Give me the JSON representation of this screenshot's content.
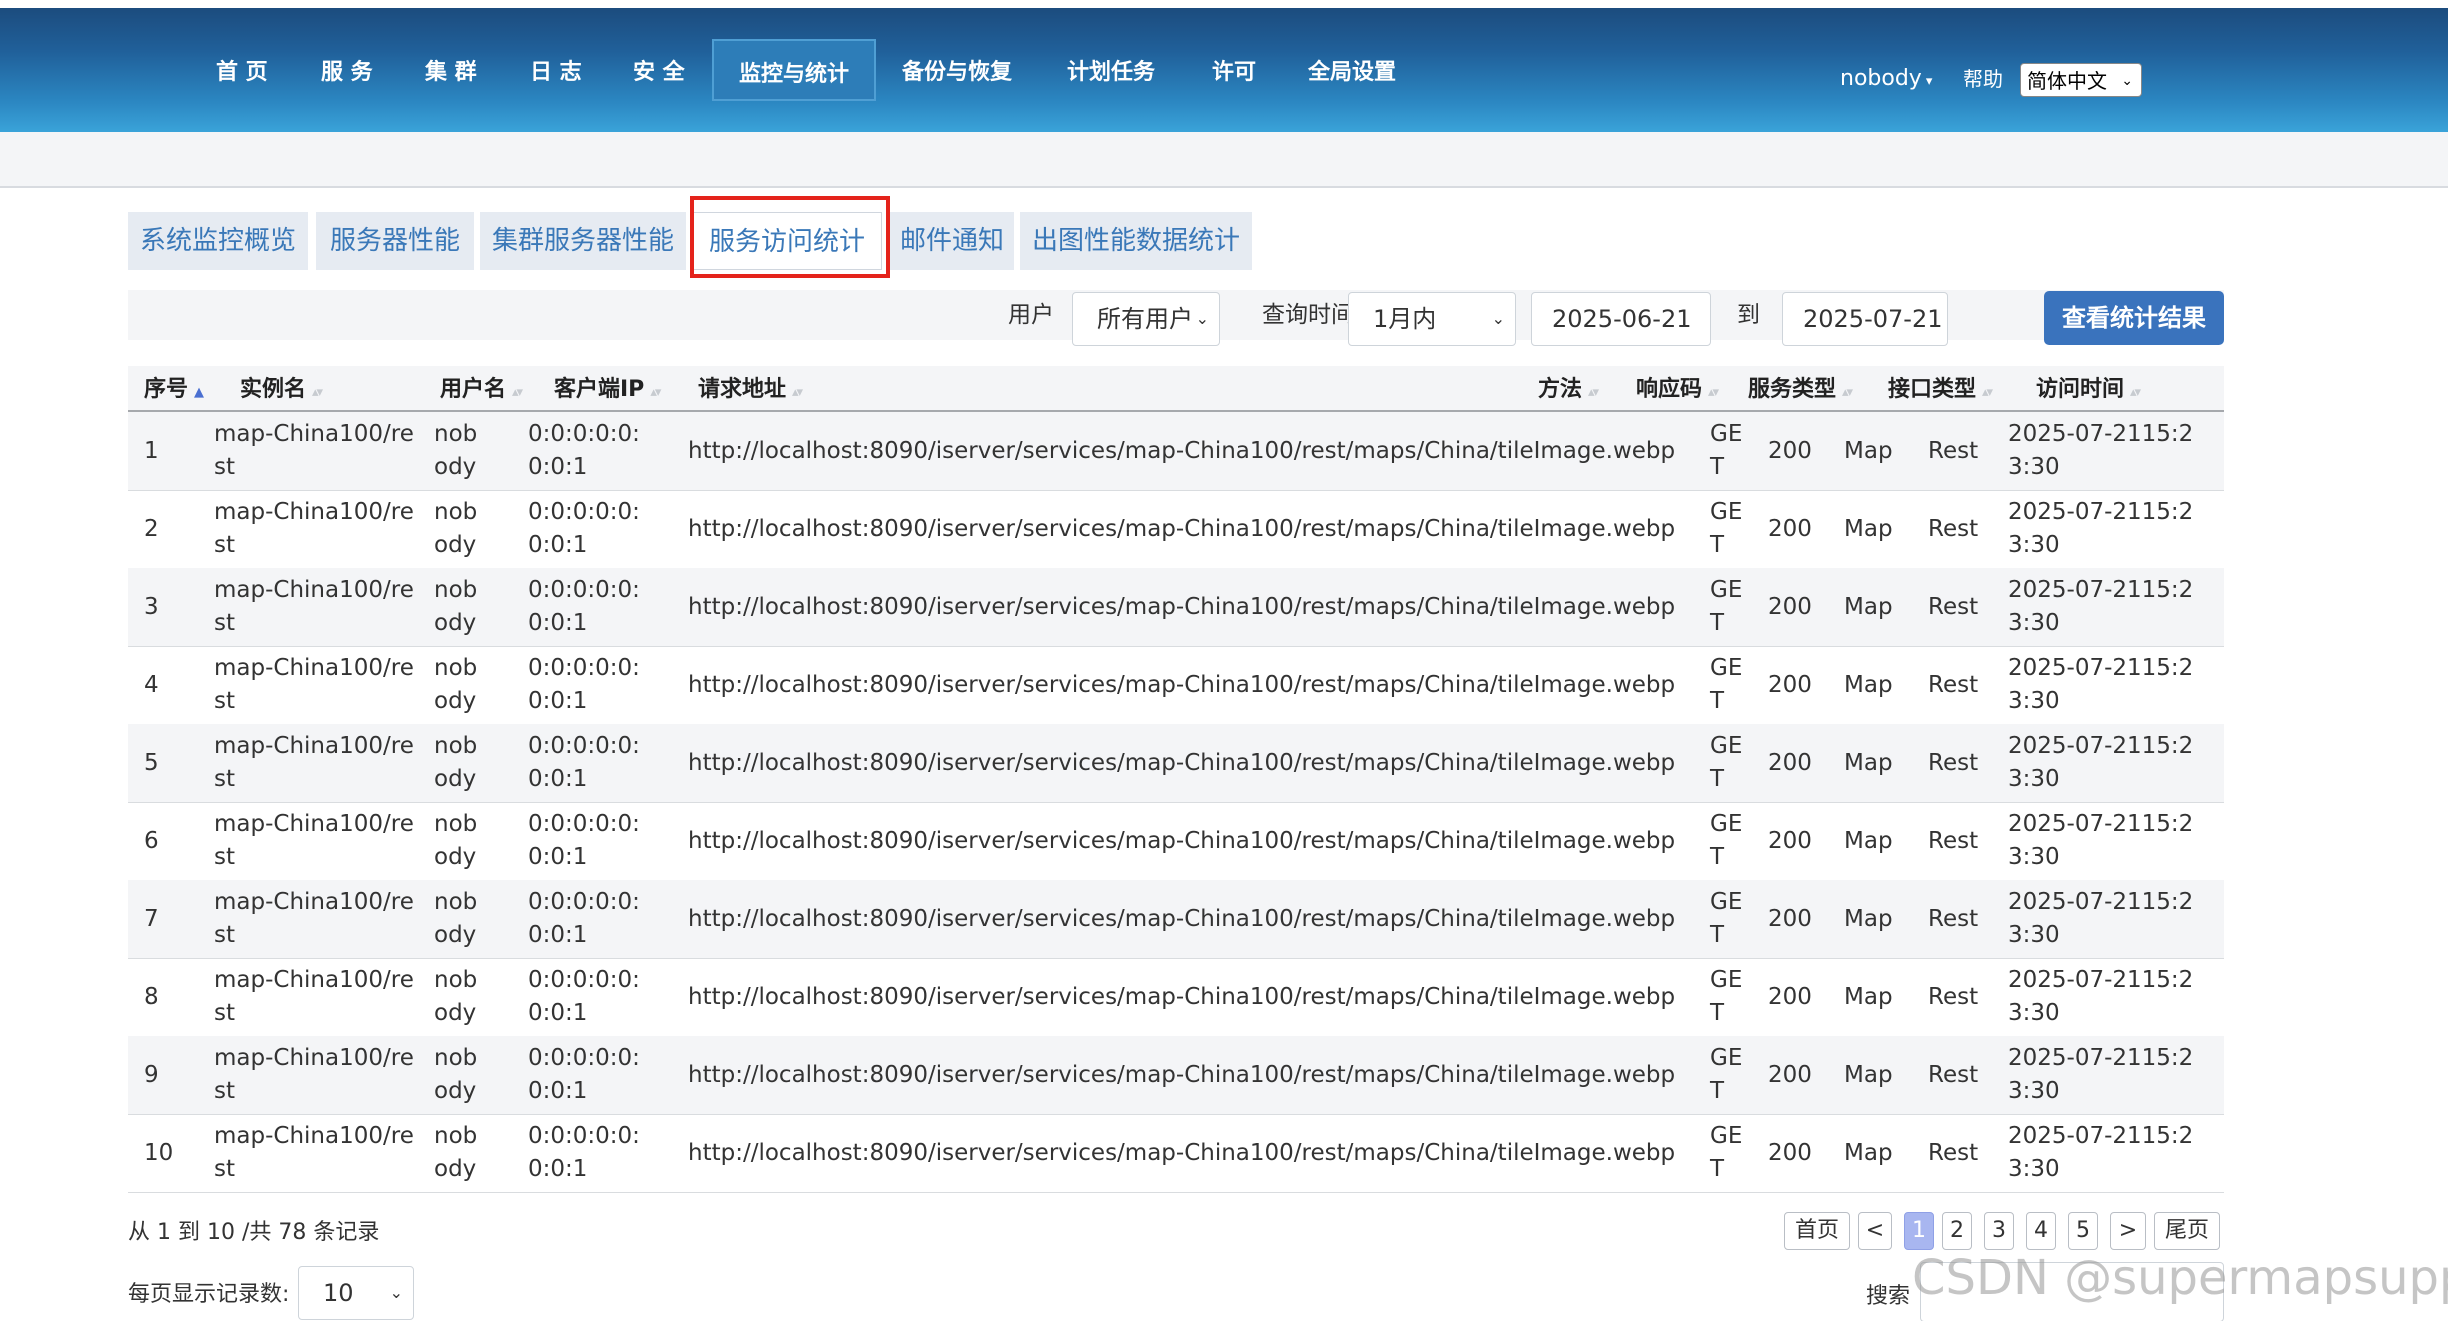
{
  "nav": {
    "items": [
      "首 页",
      "服 务",
      "集 群",
      "日 志",
      "安 全",
      "监控与统计",
      "备份与恢复",
      "计划任务",
      "许可",
      "全局设置"
    ],
    "active_index": 5,
    "user": "nobody",
    "help": "帮助",
    "language": "简体中文"
  },
  "tabs": [
    "系统监控概览",
    "服务器性能",
    "集群服务器性能",
    "服务访问统计",
    "邮件通知",
    "出图性能数据统计"
  ],
  "active_tab": 3,
  "filters": {
    "user_label": "用户",
    "user_value": "所有用户",
    "time_label": "查询时间",
    "time_value": "1月内",
    "start_date": "2025-06-21",
    "to_label": "到",
    "end_date": "2025-07-21",
    "query_button": "查看统计结果"
  },
  "table": {
    "columns": [
      "序号",
      "实例名",
      "用户名",
      "客户端IP",
      "请求地址",
      "方法",
      "响应码",
      "服务类型",
      "接口类型",
      "访问时间"
    ],
    "rows": [
      [
        "1",
        "map-China100/rest",
        "nobody",
        "0:0:0:0:0:0:0:1",
        "http://localhost:8090/iserver/services/map-China100/rest/maps/China/tileImage.webp",
        "GET",
        "200",
        "Map",
        "Rest",
        "2025-07-2115:23:30"
      ],
      [
        "2",
        "map-China100/rest",
        "nobody",
        "0:0:0:0:0:0:0:1",
        "http://localhost:8090/iserver/services/map-China100/rest/maps/China/tileImage.webp",
        "GET",
        "200",
        "Map",
        "Rest",
        "2025-07-2115:23:30"
      ],
      [
        "3",
        "map-China100/rest",
        "nobody",
        "0:0:0:0:0:0:0:1",
        "http://localhost:8090/iserver/services/map-China100/rest/maps/China/tileImage.webp",
        "GET",
        "200",
        "Map",
        "Rest",
        "2025-07-2115:23:30"
      ],
      [
        "4",
        "map-China100/rest",
        "nobody",
        "0:0:0:0:0:0:0:1",
        "http://localhost:8090/iserver/services/map-China100/rest/maps/China/tileImage.webp",
        "GET",
        "200",
        "Map",
        "Rest",
        "2025-07-2115:23:30"
      ],
      [
        "5",
        "map-China100/rest",
        "nobody",
        "0:0:0:0:0:0:0:1",
        "http://localhost:8090/iserver/services/map-China100/rest/maps/China/tileImage.webp",
        "GET",
        "200",
        "Map",
        "Rest",
        "2025-07-2115:23:30"
      ],
      [
        "6",
        "map-China100/rest",
        "nobody",
        "0:0:0:0:0:0:0:1",
        "http://localhost:8090/iserver/services/map-China100/rest/maps/China/tileImage.webp",
        "GET",
        "200",
        "Map",
        "Rest",
        "2025-07-2115:23:30"
      ],
      [
        "7",
        "map-China100/rest",
        "nobody",
        "0:0:0:0:0:0:0:1",
        "http://localhost:8090/iserver/services/map-China100/rest/maps/China/tileImage.webp",
        "GET",
        "200",
        "Map",
        "Rest",
        "2025-07-2115:23:30"
      ],
      [
        "8",
        "map-China100/rest",
        "nobody",
        "0:0:0:0:0:0:0:1",
        "http://localhost:8090/iserver/services/map-China100/rest/maps/China/tileImage.webp",
        "GET",
        "200",
        "Map",
        "Rest",
        "2025-07-2115:23:30"
      ],
      [
        "9",
        "map-China100/rest",
        "nobody",
        "0:0:0:0:0:0:0:1",
        "http://localhost:8090/iserver/services/map-China100/rest/maps/China/tileImage.webp",
        "GET",
        "200",
        "Map",
        "Rest",
        "2025-07-2115:23:30"
      ],
      [
        "10",
        "map-China100/rest",
        "nobody",
        "0:0:0:0:0:0:0:1",
        "http://localhost:8090/iserver/services/map-China100/rest/maps/China/tileImage.webp",
        "GET",
        "200",
        "Map",
        "Rest",
        "2025-07-2115:23:30"
      ]
    ]
  },
  "footer": {
    "records_info": "从 1 到 10 /共 78 条记录",
    "page_size_label": "每页显示记录数:",
    "page_size": "10",
    "pagination": [
      "首页",
      "<",
      "1",
      "2",
      "3",
      "4",
      "5",
      ">",
      "尾页"
    ],
    "current_page": "1",
    "search_label": "搜索"
  },
  "watermark": "CSDN @supermapsupport",
  "colors": {
    "nav_top": "#1c4c7e",
    "nav_bottom": "#3aa3d9",
    "tab_text": "#3a78b8",
    "highlight": "#e4231b",
    "button": "#3a73bd",
    "active_page": "#a8b6f0"
  }
}
